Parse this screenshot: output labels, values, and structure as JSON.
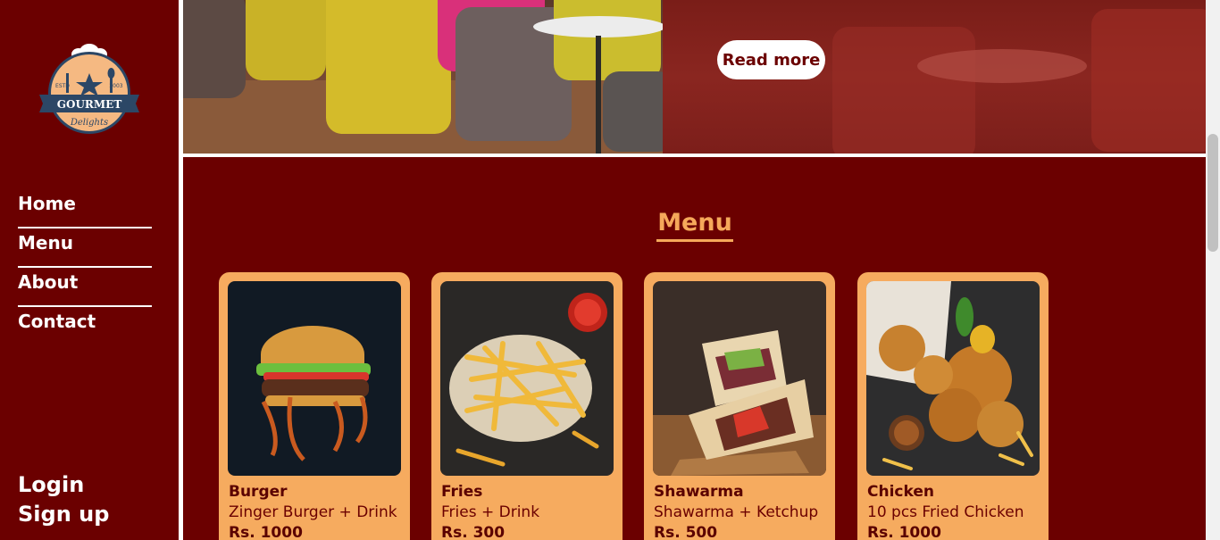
{
  "logo": {
    "top_text": "ESTD",
    "year": "2003",
    "brand": "GOURMET",
    "sub": "Delights"
  },
  "nav": {
    "items": [
      "Home",
      "Menu",
      "About",
      "Contact"
    ]
  },
  "auth": {
    "login": "Login",
    "signup": "Sign up"
  },
  "hero": {
    "button_label": "Read more"
  },
  "menu": {
    "title": "Menu",
    "items": [
      {
        "name": "Burger",
        "desc": "Zinger Burger + Drink",
        "price": "Rs. 1000"
      },
      {
        "name": "Fries",
        "desc": "Fries + Drink",
        "price": "Rs. 300"
      },
      {
        "name": "Shawarma",
        "desc": "Shawarma + Ketchup",
        "price": "Rs. 500"
      },
      {
        "name": "Chicken",
        "desc": "10 pcs Fried Chicken",
        "price": "Rs. 1000"
      }
    ]
  },
  "colors": {
    "primary": "#6b0000",
    "accent": "#f6ab5f",
    "text_light": "#ffffff"
  }
}
